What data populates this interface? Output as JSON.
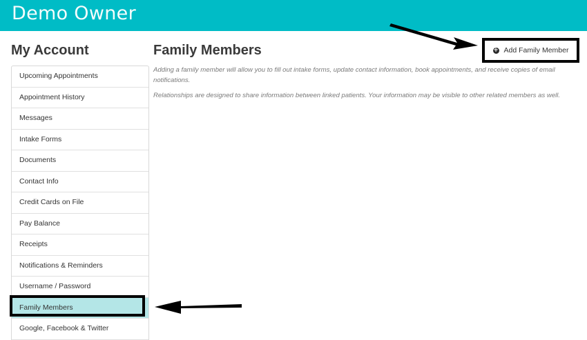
{
  "header": {
    "title": "Demo Owner"
  },
  "sidebar": {
    "title": "My Account",
    "items": [
      {
        "label": "Upcoming Appointments",
        "active": false
      },
      {
        "label": "Appointment History",
        "active": false
      },
      {
        "label": "Messages",
        "active": false
      },
      {
        "label": "Intake Forms",
        "active": false
      },
      {
        "label": "Documents",
        "active": false
      },
      {
        "label": "Contact Info",
        "active": false
      },
      {
        "label": "Credit Cards on File",
        "active": false
      },
      {
        "label": "Pay Balance",
        "active": false
      },
      {
        "label": "Receipts",
        "active": false
      },
      {
        "label": "Notifications & Reminders",
        "active": false
      },
      {
        "label": "Username / Password",
        "active": false
      },
      {
        "label": "Family Members",
        "active": true
      },
      {
        "label": "Google, Facebook & Twitter",
        "active": false
      }
    ]
  },
  "main": {
    "title": "Family Members",
    "add_button_label": "Add Family Member",
    "add_button_icon": "plus-circle-icon",
    "description_1": "Adding a family member will allow you to fill out intake forms, update contact information, book appointments, and receive copies of email notifications.",
    "description_2": "Relationships are designed to share information between linked patients. Your information may be visible to other related members as well."
  },
  "colors": {
    "header_bg": "#00bcc6",
    "active_item_bg": "#b4e6e7",
    "annotation": "#000000"
  }
}
